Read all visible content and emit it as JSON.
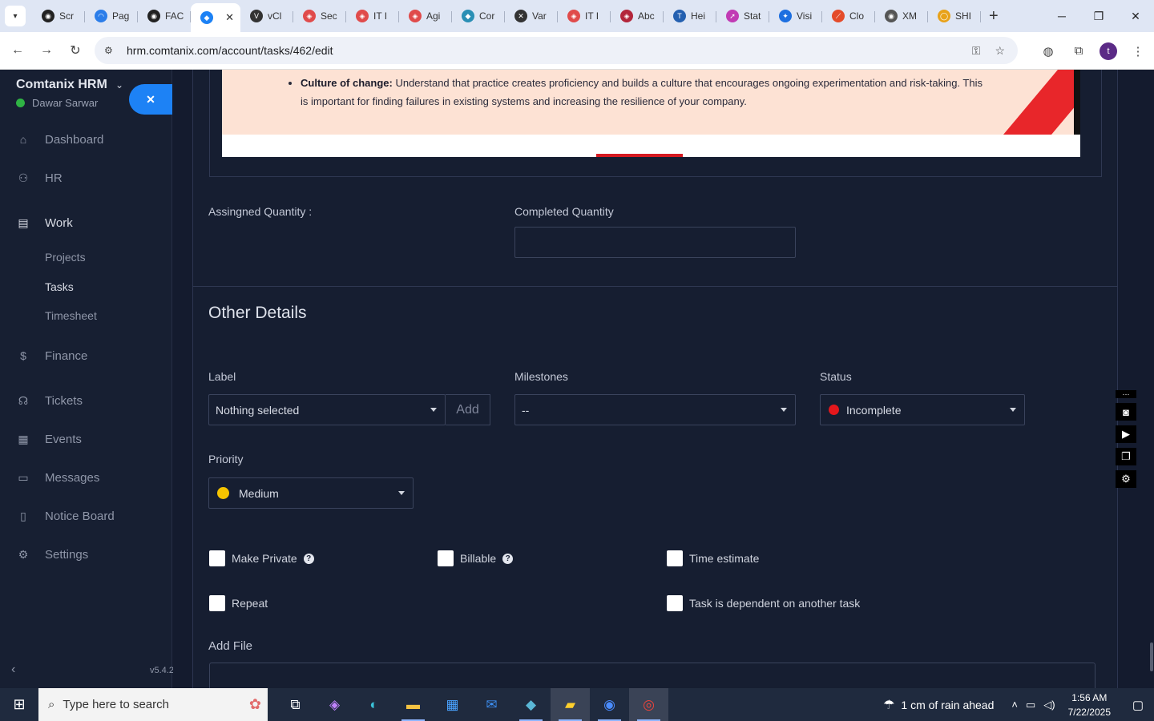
{
  "browser": {
    "tabs": [
      {
        "label": "Scr",
        "color": "#222",
        "glyph": "◉"
      },
      {
        "label": "Pag",
        "color": "#2b7de9",
        "glyph": "◠"
      },
      {
        "label": "FAC",
        "color": "#222",
        "glyph": "◉"
      },
      {
        "label": "",
        "color": "#1d82f5",
        "glyph": "◆",
        "active": true
      },
      {
        "label": "vCl",
        "color": "#333",
        "glyph": "V"
      },
      {
        "label": "Sec",
        "color": "#e04b4b",
        "glyph": "◈"
      },
      {
        "label": "IT I",
        "color": "#e04b4b",
        "glyph": "◈"
      },
      {
        "label": "Agi",
        "color": "#e04b4b",
        "glyph": "◈"
      },
      {
        "label": "Cor",
        "color": "#2a8fb5",
        "glyph": "◆"
      },
      {
        "label": "Var",
        "color": "#333",
        "glyph": "✕"
      },
      {
        "label": "IT I",
        "color": "#e04b4b",
        "glyph": "◈"
      },
      {
        "label": "Abc",
        "color": "#b3263b",
        "glyph": "◈"
      },
      {
        "label": "Hei",
        "color": "#2460b0",
        "glyph": "T"
      },
      {
        "label": "Stat",
        "color": "#c13bb4",
        "glyph": "➚"
      },
      {
        "label": "Visi",
        "color": "#1d6fe0",
        "glyph": "✦"
      },
      {
        "label": "Clo",
        "color": "#e44b2a",
        "glyph": "⟋"
      },
      {
        "label": "XM",
        "color": "#555",
        "glyph": "◉"
      },
      {
        "label": "SHI",
        "color": "#e8a21a",
        "glyph": "◯"
      }
    ],
    "url": "hrm.comtanix.com/account/tasks/462/edit",
    "profile_initial": "t"
  },
  "sidebar": {
    "brand": "Comtanix HRM",
    "user": "Dawar Sarwar",
    "version": "v5.4.2",
    "menu": {
      "dashboard": "Dashboard",
      "hr": "HR",
      "work": "Work",
      "projects": "Projects",
      "tasks": "Tasks",
      "timesheet": "Timesheet",
      "finance": "Finance",
      "tickets": "Tickets",
      "events": "Events",
      "messages": "Messages",
      "notice_board": "Notice Board",
      "settings": "Settings"
    }
  },
  "banner": {
    "bold": "Culture of change:",
    "text": " Understand that practice creates proficiency and builds a culture that encourages ongoing experimentation and risk-taking. This is important for finding failures in existing systems and increasing the resilience of your company."
  },
  "form": {
    "assigned_qty_label": "Assingned Quantity :",
    "completed_qty_label": "Completed Quantity",
    "completed_qty_value": "",
    "other_details_title": "Other Details",
    "label_label": "Label",
    "label_value": "Nothing selected",
    "add_label": "Add",
    "milestones_label": "Milestones",
    "milestones_value": "--",
    "status_label": "Status",
    "status_value": "Incomplete",
    "status_color": "#e4171c",
    "priority_label": "Priority",
    "priority_value": "Medium",
    "priority_color": "#f5c400",
    "make_private": "Make Private",
    "billable": "Billable",
    "time_estimate": "Time estimate",
    "repeat": "Repeat",
    "dependent": "Task is dependent on another task",
    "add_file": "Add File"
  },
  "taskbar": {
    "search_placeholder": "Type here to search",
    "weather": "1 cm of rain ahead",
    "time": "1:56 AM",
    "date": "7/22/2025"
  }
}
